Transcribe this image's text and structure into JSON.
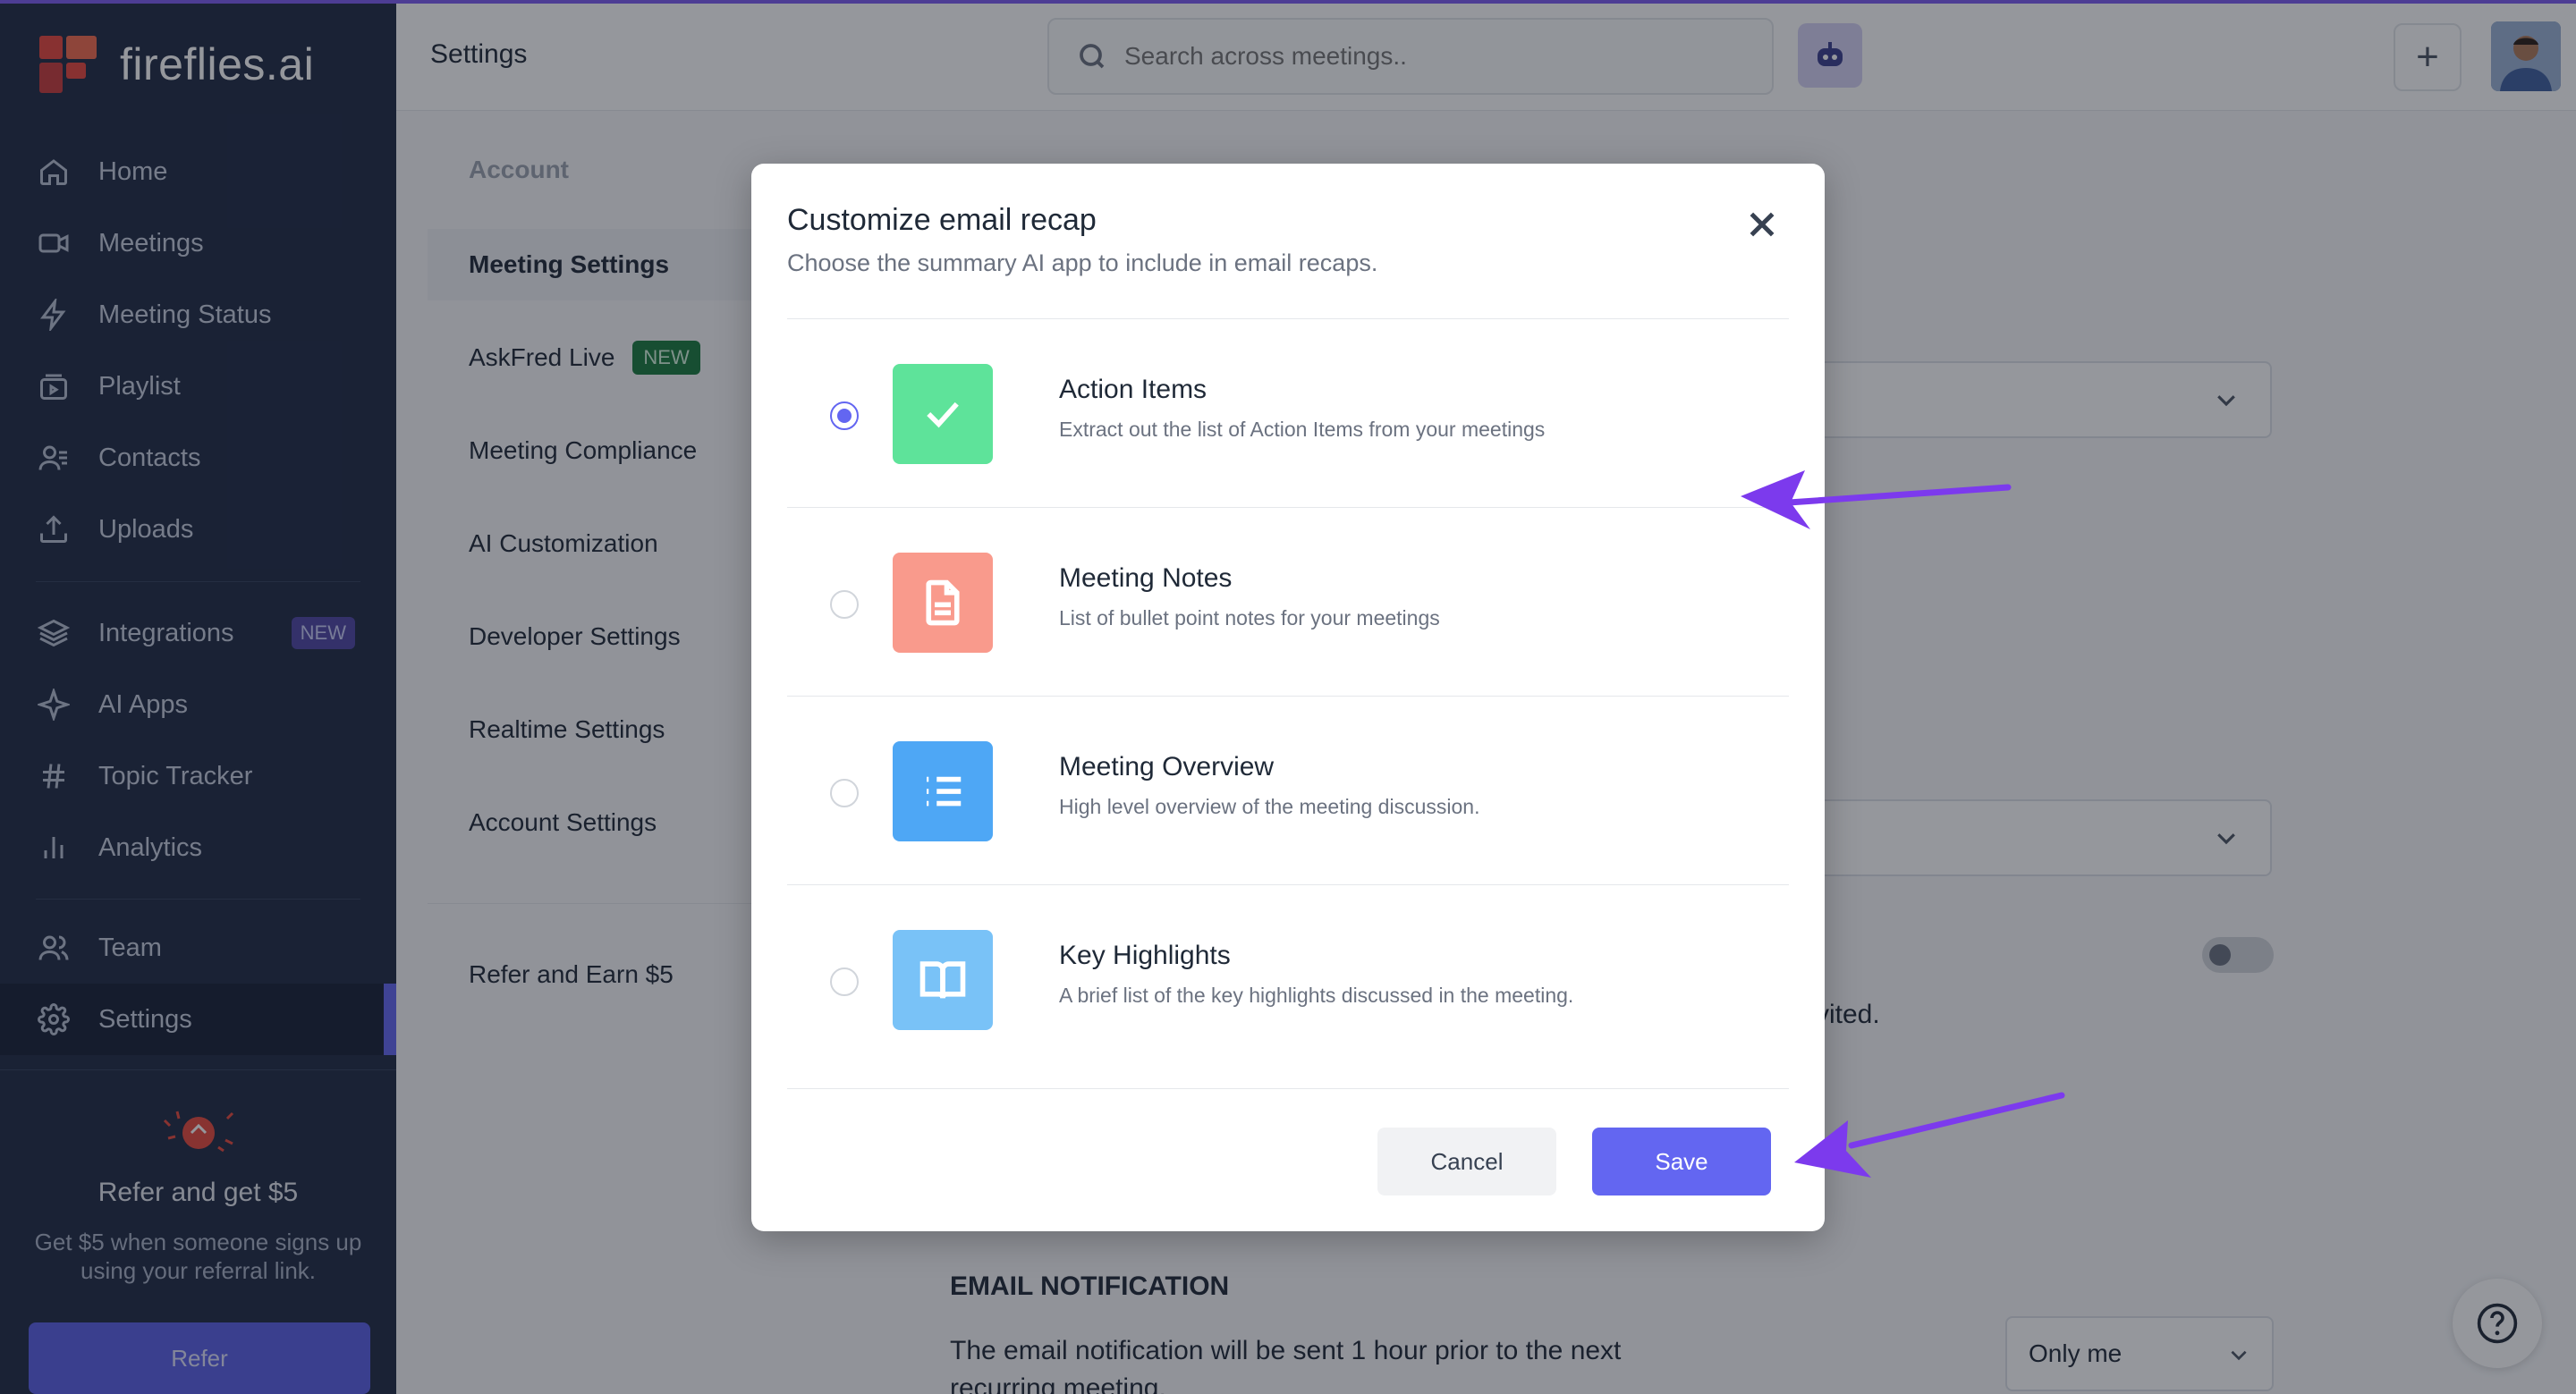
{
  "app": {
    "brand": "fireflies.ai",
    "page_title": "Settings"
  },
  "colors": {
    "accent": "#6366f1",
    "sidebar_bg": "#1f2a44",
    "arrow": "#7c3aed"
  },
  "sidebar": {
    "items": [
      {
        "label": "Home",
        "icon": "home-icon"
      },
      {
        "label": "Meetings",
        "icon": "video-icon"
      },
      {
        "label": "Meeting Status",
        "icon": "lightning-icon"
      },
      {
        "label": "Playlist",
        "icon": "playlist-icon"
      },
      {
        "label": "Contacts",
        "icon": "contacts-icon"
      },
      {
        "label": "Uploads",
        "icon": "upload-icon"
      },
      {
        "label": "Integrations",
        "icon": "layers-icon",
        "badge": "NEW"
      },
      {
        "label": "AI Apps",
        "icon": "sparkle-icon"
      },
      {
        "label": "Topic Tracker",
        "icon": "hashtag-icon"
      },
      {
        "label": "Analytics",
        "icon": "bar-chart-icon"
      },
      {
        "label": "Team",
        "icon": "team-icon"
      },
      {
        "label": "Settings",
        "icon": "gear-icon",
        "active": true
      }
    ],
    "refer": {
      "title": "Refer and get $5",
      "description": "Get $5 when someone signs up using your referral link.",
      "button": "Refer"
    }
  },
  "topbar": {
    "search_placeholder": "Search across meetings.."
  },
  "settings_nav": {
    "header": "Account",
    "items": [
      {
        "label": "Meeting Settings",
        "active": true
      },
      {
        "label": "AskFred Live",
        "badge": "NEW"
      },
      {
        "label": "Meeting Compliance"
      },
      {
        "label": "AI Customization"
      },
      {
        "label": "Developer Settings"
      },
      {
        "label": "Realtime Settings"
      },
      {
        "label": "Account Settings"
      },
      {
        "label": "Refer and Earn $5"
      }
    ]
  },
  "background": {
    "invited_fragment": "vited.",
    "email_notification_heading": "EMAIL NOTIFICATION",
    "email_notification_text": "The email notification will be sent 1 hour prior to the next",
    "email_notification_text_2": "recurring meeting.",
    "only_me_select": "Only me"
  },
  "modal": {
    "title": "Customize email recap",
    "subtitle": "Choose the summary AI app to include in email recaps.",
    "options": [
      {
        "title": "Action Items",
        "description": "Extract out the list of Action Items from your meetings",
        "icon": "check-icon",
        "color": "#5ee39a",
        "selected": true
      },
      {
        "title": "Meeting Notes",
        "description": "List of bullet point notes for your meetings",
        "icon": "document-icon",
        "color": "#f99a8c",
        "selected": false
      },
      {
        "title": "Meeting Overview",
        "description": "High level overview of the meeting discussion.",
        "icon": "list-icon",
        "color": "#4ea7f5",
        "selected": false
      },
      {
        "title": "Key Highlights",
        "description": "A brief list of the key highlights discussed in the meeting.",
        "icon": "book-icon",
        "color": "#79c2f7",
        "selected": false
      }
    ],
    "cancel_label": "Cancel",
    "save_label": "Save"
  }
}
